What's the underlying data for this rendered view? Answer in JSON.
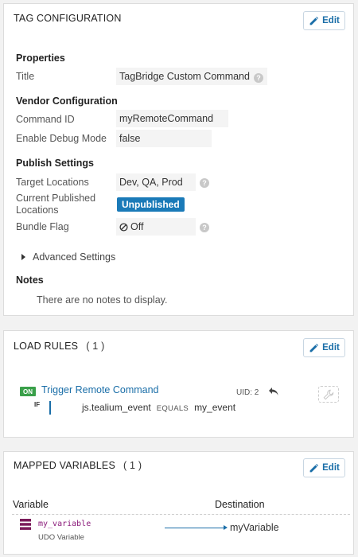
{
  "tag_config": {
    "title": "TAG CONFIGURATION",
    "edit_label": "Edit",
    "properties": {
      "heading": "Properties",
      "title_label": "Title",
      "title_value": "TagBridge Custom Command"
    },
    "vendor": {
      "heading": "Vendor Configuration",
      "command_id_label": "Command ID",
      "command_id_value": "myRemoteCommand",
      "debug_label": "Enable Debug Mode",
      "debug_value": "false"
    },
    "publish": {
      "heading": "Publish Settings",
      "target_label": "Target Locations",
      "target_value": "Dev, QA, Prod",
      "current_label_line1": "Current Published",
      "current_label_line2": "Locations",
      "current_value": "Unpublished",
      "bundle_label": "Bundle Flag",
      "bundle_value": "Off"
    },
    "advanced_label": "Advanced Settings",
    "notes": {
      "heading": "Notes",
      "empty_text": "There are no notes to display."
    }
  },
  "load_rules": {
    "title": "LOAD RULES",
    "count": "( 1 )",
    "edit_label": "Edit",
    "rule": {
      "status": "ON",
      "name": "Trigger Remote Command",
      "uid_label": "UID:",
      "uid_value": "2",
      "if_label": "IF",
      "variable": "js.tealium_event",
      "operator": "EQUALS",
      "value": "my_event"
    }
  },
  "mapped_vars": {
    "title": "MAPPED VARIABLES",
    "count": "( 1 )",
    "edit_label": "Edit",
    "col_variable": "Variable",
    "col_destination": "Destination",
    "row": {
      "name": "my_variable",
      "type": "UDO Variable",
      "destination": "myVariable"
    }
  },
  "colors": {
    "accent": "#1a6ea8",
    "on_badge": "#3aa04a",
    "unpublished": "#1a7ab8",
    "variable_name": "#8a1a7a"
  }
}
